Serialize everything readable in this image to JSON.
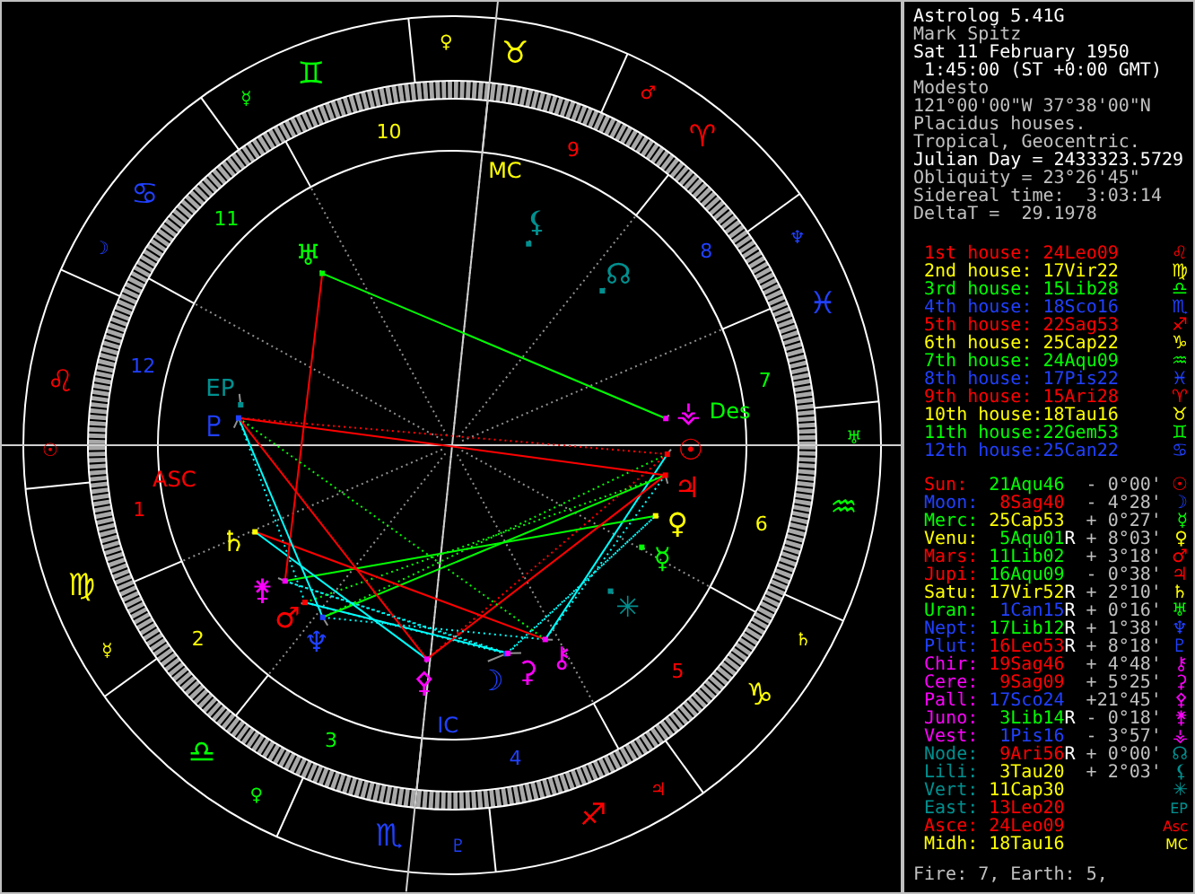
{
  "header": [
    {
      "text": "Astrolog 5.41G",
      "color": "#ffffff"
    },
    {
      "text": "Mark Spitz",
      "color": "#c0c0c0"
    },
    {
      "text": "Sat 11 February 1950",
      "color": "#ffffff"
    },
    {
      "text": " 1:45:00 (ST +0:00 GMT)",
      "color": "#ffffff"
    },
    {
      "text": "Modesto",
      "color": "#c0c0c0"
    },
    {
      "text": "121°00'00\"W 37°38'00\"N",
      "color": "#c0c0c0"
    },
    {
      "text": "Placidus houses.",
      "color": "#c0c0c0"
    },
    {
      "text": "Tropical, Geocentric.",
      "color": "#c0c0c0"
    },
    {
      "text": "Julian Day = 2433323.5729",
      "color": "#ffffff"
    },
    {
      "text": "Obliquity = 23°26'45\"",
      "color": "#c0c0c0"
    },
    {
      "text": "Sidereal time:  3:03:14",
      "color": "#c0c0c0"
    },
    {
      "text": "DeltaT =  29.1978",
      "color": "#c0c0c0"
    }
  ],
  "houses": [
    {
      "label": "1st house:",
      "position": "24Leo09",
      "glyph": "♌",
      "color": "#ff0000"
    },
    {
      "label": "2nd house:",
      "position": "17Vir22",
      "glyph": "♍",
      "color": "#ffff00"
    },
    {
      "label": "3rd house:",
      "position": "15Lib28",
      "glyph": "♎",
      "color": "#00ff00"
    },
    {
      "label": "4th house:",
      "position": "18Sco16",
      "glyph": "♏",
      "color": "#2040ff"
    },
    {
      "label": "5th house:",
      "position": "22Sag53",
      "glyph": "♐",
      "color": "#ff0000"
    },
    {
      "label": "6th house:",
      "position": "25Cap22",
      "glyph": "♑",
      "color": "#ffff00"
    },
    {
      "label": "7th house:",
      "position": "24Aqu09",
      "glyph": "♒",
      "color": "#00ff00"
    },
    {
      "label": "8th house:",
      "position": "17Pis22",
      "glyph": "♓",
      "color": "#2040ff"
    },
    {
      "label": "9th house:",
      "position": "15Ari28",
      "glyph": "♈",
      "color": "#ff0000"
    },
    {
      "label": "10th house:",
      "position": "18Tau16",
      "glyph": "♉",
      "color": "#ffff00"
    },
    {
      "label": "11th house:",
      "position": "22Gem53",
      "glyph": "♊",
      "color": "#00ff00"
    },
    {
      "label": "12th house:",
      "position": "25Can22",
      "glyph": "♋",
      "color": "#2040ff"
    }
  ],
  "objects": [
    {
      "kind": "planet",
      "name": "Sun:",
      "position": {
        "text": "21Aqu46",
        "color": "#00ff00"
      },
      "offset": "- 0°00'",
      "glyph": "☉",
      "wheel_glyph": "☉",
      "color": "#ff0000"
    },
    {
      "kind": "planet",
      "name": "Moon:",
      "position": {
        "text": "8Sag40",
        "color": "#ff0000"
      },
      "offset": "- 4°28'",
      "glyph": "☽",
      "wheel_glyph": "☽",
      "color": "#2040ff"
    },
    {
      "kind": "planet",
      "name": "Merc:",
      "position": {
        "text": "25Cap53",
        "color": "#ffff00"
      },
      "offset": "+ 0°27'",
      "glyph": "☿",
      "wheel_glyph": "☿",
      "color": "#00ff00"
    },
    {
      "kind": "planet",
      "name": "Venu:",
      "position": {
        "text": "5Aqu01",
        "color": "#00ff00"
      },
      "retrograde_flag": "R",
      "offset": "+ 8°03'",
      "glyph": "♀",
      "wheel_glyph": "♀",
      "color": "#ffff00"
    },
    {
      "kind": "planet",
      "name": "Mars:",
      "position": {
        "text": "11Lib02",
        "color": "#00ff00"
      },
      "offset": "+ 3°18'",
      "glyph": "♂",
      "wheel_glyph": "♂",
      "color": "#ff0000"
    },
    {
      "kind": "planet",
      "name": "Jupi:",
      "position": {
        "text": "16Aqu09",
        "color": "#00ff00"
      },
      "offset": "- 0°38'",
      "glyph": "♃",
      "wheel_glyph": "♃",
      "color": "#ff0000"
    },
    {
      "kind": "planet",
      "name": "Satu:",
      "position": {
        "text": "17Vir52",
        "color": "#ffff00"
      },
      "retrograde_flag": "R",
      "offset": "+ 2°10'",
      "glyph": "♄",
      "wheel_glyph": "♄",
      "color": "#ffff00"
    },
    {
      "kind": "planet",
      "name": "Uran:",
      "position": {
        "text": "1Can15",
        "color": "#2040ff"
      },
      "retrograde_flag": "R",
      "offset": "+ 0°16'",
      "glyph": "♅",
      "wheel_glyph": "♅",
      "color": "#00ff00"
    },
    {
      "kind": "planet",
      "name": "Nept:",
      "position": {
        "text": "17Lib12",
        "color": "#00ff00"
      },
      "retrograde_flag": "R",
      "offset": "+ 1°38'",
      "glyph": "♆",
      "wheel_glyph": "♆",
      "color": "#2040ff"
    },
    {
      "kind": "planet",
      "name": "Plut:",
      "position": {
        "text": "16Leo53",
        "color": "#ff0000"
      },
      "retrograde_flag": "R",
      "offset": "+ 8°18'",
      "glyph": "♇",
      "wheel_glyph": "♇",
      "color": "#2040ff"
    },
    {
      "kind": "planet",
      "name": "Chir:",
      "position": {
        "text": "19Sag46",
        "color": "#ff0000"
      },
      "offset": "+ 4°48'",
      "glyph": "⚷",
      "wheel_glyph": "⚷",
      "color": "#ff00ff"
    },
    {
      "kind": "planet",
      "name": "Cere:",
      "position": {
        "text": "9Sag09",
        "color": "#ff0000"
      },
      "offset": "+ 5°25'",
      "glyph": "⚳",
      "wheel_glyph": "⚳",
      "color": "#ff00ff"
    },
    {
      "kind": "planet",
      "name": "Pall:",
      "position": {
        "text": "17Sco24",
        "color": "#2040ff"
      },
      "offset": "+21°45'",
      "glyph": "⚴",
      "wheel_glyph": "⚴",
      "color": "#ff00ff"
    },
    {
      "kind": "planet",
      "name": "Juno:",
      "position": {
        "text": "3Lib14",
        "color": "#00ff00"
      },
      "retrograde_flag": "R",
      "offset": "- 0°18'",
      "glyph": "⚵",
      "wheel_glyph": "⚵",
      "color": "#ff00ff"
    },
    {
      "kind": "planet",
      "name": "Vest:",
      "position": {
        "text": "1Pis16",
        "color": "#2040ff"
      },
      "offset": "- 3°57'",
      "glyph": "⚶",
      "wheel_glyph": "⚶",
      "color": "#ff00ff"
    },
    {
      "kind": "point",
      "name": "Node:",
      "position": {
        "text": "9Ari56",
        "color": "#ff0000"
      },
      "retrograde_flag": "R",
      "offset": "+ 0°00'",
      "glyph": "☊",
      "wheel_glyph": "☊",
      "color": "#009090"
    },
    {
      "kind": "point",
      "name": "Lili:",
      "position": {
        "text": "3Tau20",
        "color": "#ffff00"
      },
      "offset": "+ 2°03'",
      "glyph": "⚸",
      "wheel_glyph": "⚸",
      "color": "#009090"
    },
    {
      "kind": "point",
      "name": "Vert:",
      "position": {
        "text": "11Cap30",
        "color": "#ffff00"
      },
      "glyph": "✳",
      "wheel_glyph": "✳",
      "color": "#009090"
    },
    {
      "kind": "point",
      "name": "East:",
      "position": {
        "text": "13Leo20",
        "color": "#ff0000"
      },
      "glyph": "EP",
      "wheel_glyph": "EP",
      "color": "#009090"
    },
    {
      "kind": "asc",
      "name": "Asce:",
      "position": {
        "text": "24Leo09",
        "color": "#ff0000"
      },
      "glyph": "Asc",
      "color": "#ff0000"
    },
    {
      "kind": "mc",
      "name": "Midh:",
      "position": {
        "text": "18Tau16",
        "color": "#ffff00"
      },
      "glyph": "MC",
      "color": "#ffff00"
    }
  ],
  "footer": "Fire: 7, Earth: 5,",
  "wheel": {
    "signs": [
      {
        "glyph": "♈",
        "ruler": "♂",
        "color": "#ff0000"
      },
      {
        "glyph": "♉",
        "ruler": "♀",
        "color": "#ffff00"
      },
      {
        "glyph": "♊",
        "ruler": "☿",
        "color": "#00ff00"
      },
      {
        "glyph": "♋",
        "ruler": "☽",
        "color": "#2040ff"
      },
      {
        "glyph": "♌",
        "ruler": "☉",
        "color": "#ff0000"
      },
      {
        "glyph": "♍",
        "ruler": "☿",
        "color": "#ffff00"
      },
      {
        "glyph": "♎",
        "ruler": "♀",
        "color": "#00ff00"
      },
      {
        "glyph": "♏",
        "ruler": "♇",
        "color": "#2040ff"
      },
      {
        "glyph": "♐",
        "ruler": "♃",
        "color": "#ff0000"
      },
      {
        "glyph": "♑",
        "ruler": "♄",
        "color": "#ffff00"
      },
      {
        "glyph": "♒",
        "ruler": "♅",
        "color": "#00ff00"
      },
      {
        "glyph": "♓",
        "ruler": "♆",
        "color": "#2040ff"
      }
    ],
    "house_numbers": [
      {
        "text": "1",
        "color": "#ff0000"
      },
      {
        "text": "2",
        "color": "#ffff00"
      },
      {
        "text": "3",
        "color": "#00ff00"
      },
      {
        "text": "4",
        "color": "#2040ff"
      },
      {
        "text": "5",
        "color": "#ff0000"
      },
      {
        "text": "6",
        "color": "#ffff00"
      },
      {
        "text": "7",
        "color": "#00ff00"
      },
      {
        "text": "8",
        "color": "#2040ff"
      },
      {
        "text": "9",
        "color": "#ff0000"
      },
      {
        "text": "10",
        "color": "#ffff00"
      },
      {
        "text": "11",
        "color": "#00ff00"
      },
      {
        "text": "12",
        "color": "#2040ff"
      }
    ],
    "angle_labels": [
      {
        "kind": "asc",
        "text": "ASC",
        "color": "#ff0000"
      },
      {
        "kind": "mc",
        "text": "MC",
        "color": "#ffff00"
      },
      {
        "kind": "des",
        "text": "Des",
        "color": "#00ff00"
      },
      {
        "kind": "ic",
        "text": "IC",
        "color": "#2040ff"
      }
    ]
  }
}
